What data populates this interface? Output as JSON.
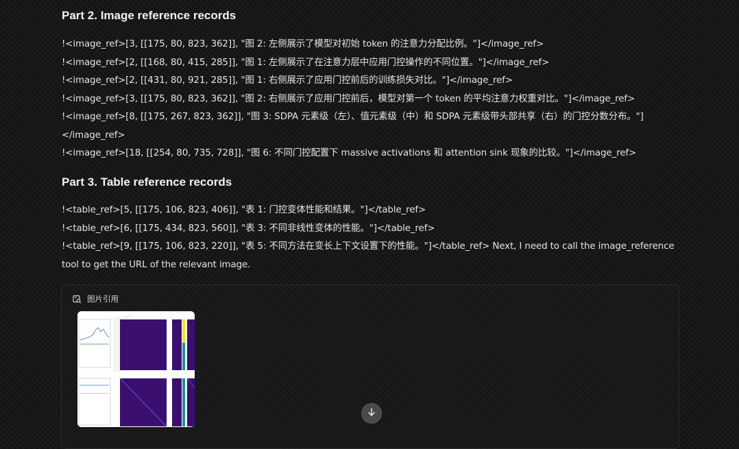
{
  "part2": {
    "heading": "Part 2. Image reference records",
    "lines": [
      "!<image_ref>[3, [[175, 80, 823, 362]], \"图 2: 左侧展示了模型对初始 token 的注意力分配比例。\"]</image_ref>",
      "!<image_ref>[2, [[168, 80, 415, 285]], \"图 1: 左侧展示了在注意力层中应用门控操作的不同位置。\"]</image_ref>",
      "!<image_ref>[2, [[431, 80, 921, 285]], \"图 1: 右侧展示了应用门控前后的训练损失对比。\"]</image_ref>",
      "!<image_ref>[3, [[175, 80, 823, 362]], \"图 2: 右侧展示了应用门控前后，模型对第一个 token 的平均注意力权重对比。\"]</image_ref>",
      "!<image_ref>[8, [[175, 267, 823, 362]], \"图 3: SDPA 元素级（左）、值元素级（中）和 SDPA 元素级带头部共享（右）的门控分数分布。\"]</image_ref>",
      "!<image_ref>[18, [[254, 80, 735, 728]], \"图 6: 不同门控配置下 massive activations 和 attention sink 现象的比较。\"]</image_ref>"
    ]
  },
  "part3": {
    "heading": "Part 3. Table reference records",
    "lines": [
      "!<table_ref>[5, [[175, 106, 823, 406]], \"表 1: 门控变体性能和结果。\"]</table_ref>",
      "!<table_ref>[6, [[175, 434, 823, 560]], \"表 3: 不同非线性变体的性能。\"]</table_ref>",
      "!<table_ref>[9, [[175, 106, 823, 220]], \"表 5: 不同方法在变长上下文设置下的性能。\"]</table_ref> Next, I need to call the image_reference tool to get the URL of the relevant image."
    ]
  },
  "card": {
    "title": "图片引用",
    "icon": "image-search-icon",
    "thumbnail_icon": "figure-thumbnail"
  },
  "scroll_button": {
    "icon": "arrow-down-icon"
  },
  "colors": {
    "background": "#141414",
    "text": "#ececec",
    "card_border": "#2c2c2c",
    "heatmap": "#3b0f6f"
  }
}
